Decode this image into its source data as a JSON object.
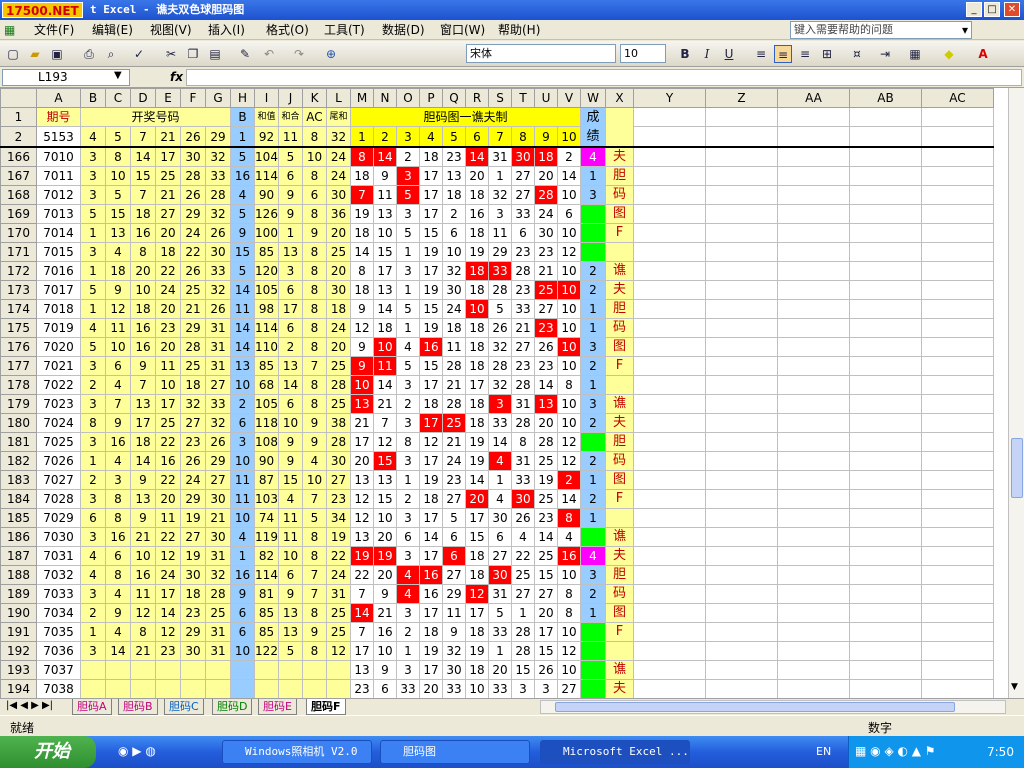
{
  "window": {
    "logo": "17500.NET",
    "title": "t Excel - 谯夫双色球胆码图",
    "buttons": [
      "_",
      "□",
      "✕"
    ]
  },
  "menu": [
    "文件(F)",
    "编辑(E)",
    "视图(V)",
    "插入(I)",
    "格式(O)",
    "工具(T)",
    "数据(D)",
    "窗口(W)",
    "帮助(H)"
  ],
  "help_placeholder": "键入需要帮助的问题",
  "toolbar": {
    "font": "宋体",
    "size": "10",
    "bold": "B",
    "italic": "I",
    "underline": "U"
  },
  "formula": {
    "namebox": "L193",
    "fx": "fx",
    "value": ""
  },
  "columns": [
    "A",
    "B",
    "C",
    "D",
    "E",
    "F",
    "G",
    "H",
    "I",
    "J",
    "K",
    "L",
    "M",
    "N",
    "O",
    "P",
    "Q",
    "R",
    "S",
    "T",
    "U",
    "V",
    "W",
    "X",
    "Y",
    "Z",
    "AA",
    "AB",
    "AC"
  ],
  "header_row1": {
    "row": "1",
    "period": "期号",
    "kjhm": "开奖号码",
    "blue": "B",
    "hezhi": "和值",
    "hehe": "和合",
    "ac": "AC",
    "weihe": "尾和",
    "danma": "胆码图一谯夫制",
    "chengji": "成绩"
  },
  "header_row2": {
    "row": "2",
    "period": "5153",
    "nums": [
      "4",
      "5",
      "7",
      "21",
      "26",
      "29"
    ],
    "blue": "1",
    "hezhi": "92",
    "hehe": "11",
    "ac": "8",
    "weihe": "32",
    "danma": [
      "1",
      "2",
      "3",
      "4",
      "5",
      "6",
      "7",
      "8",
      "9",
      "10"
    ],
    "chengji": ""
  },
  "rows": [
    {
      "r": "166",
      "p": "7010",
      "n": [
        "3",
        "8",
        "14",
        "17",
        "30",
        "32"
      ],
      "b": "5",
      "h": "104",
      "hh": "5",
      "ac": "10",
      "w": "24",
      "m": [
        "8",
        "14",
        "2",
        "18",
        "23",
        "14",
        "31",
        "30",
        "18",
        "2"
      ],
      "red": [
        0,
        1,
        5,
        7,
        8
      ],
      "s": "4",
      "sc": "m",
      "x": "夫"
    },
    {
      "r": "167",
      "p": "7011",
      "n": [
        "3",
        "10",
        "15",
        "25",
        "28",
        "33"
      ],
      "b": "16",
      "h": "114",
      "hh": "6",
      "ac": "8",
      "w": "24",
      "m": [
        "18",
        "9",
        "3",
        "17",
        "13",
        "20",
        "1",
        "27",
        "20",
        "14"
      ],
      "red": [
        2
      ],
      "s": "1",
      "sc": "b",
      "x": "胆"
    },
    {
      "r": "168",
      "p": "7012",
      "n": [
        "3",
        "5",
        "7",
        "21",
        "26",
        "28"
      ],
      "b": "4",
      "h": "90",
      "hh": "9",
      "ac": "6",
      "w": "30",
      "m": [
        "7",
        "11",
        "5",
        "17",
        "18",
        "18",
        "32",
        "27",
        "28",
        "10"
      ],
      "red": [
        0,
        2,
        8
      ],
      "s": "3",
      "sc": "b",
      "x": "码"
    },
    {
      "r": "169",
      "p": "7013",
      "n": [
        "5",
        "15",
        "18",
        "27",
        "29",
        "32"
      ],
      "b": "5",
      "h": "126",
      "hh": "9",
      "ac": "8",
      "w": "36",
      "m": [
        "19",
        "13",
        "3",
        "17",
        "2",
        "16",
        "3",
        "33",
        "24",
        "6"
      ],
      "red": [],
      "s": "",
      "sc": "g",
      "x": "图"
    },
    {
      "r": "170",
      "p": "7014",
      "n": [
        "1",
        "13",
        "16",
        "20",
        "24",
        "26"
      ],
      "b": "9",
      "h": "100",
      "hh": "1",
      "ac": "9",
      "w": "20",
      "m": [
        "18",
        "10",
        "5",
        "15",
        "6",
        "18",
        "11",
        "6",
        "30",
        "10"
      ],
      "red": [],
      "s": "",
      "sc": "g",
      "x": "F"
    },
    {
      "r": "171",
      "p": "7015",
      "n": [
        "3",
        "4",
        "8",
        "18",
        "22",
        "30"
      ],
      "b": "15",
      "h": "85",
      "hh": "13",
      "ac": "8",
      "w": "25",
      "m": [
        "14",
        "15",
        "1",
        "19",
        "10",
        "19",
        "29",
        "23",
        "23",
        "12"
      ],
      "red": [],
      "s": "",
      "sc": "g",
      "x": ""
    },
    {
      "r": "172",
      "p": "7016",
      "n": [
        "1",
        "18",
        "20",
        "22",
        "26",
        "33"
      ],
      "b": "5",
      "h": "120",
      "hh": "3",
      "ac": "8",
      "w": "20",
      "m": [
        "8",
        "17",
        "3",
        "17",
        "32",
        "18",
        "33",
        "28",
        "21",
        "10"
      ],
      "red": [
        5,
        6
      ],
      "s": "2",
      "sc": "b",
      "x": "谯"
    },
    {
      "r": "173",
      "p": "7017",
      "n": [
        "5",
        "9",
        "10",
        "24",
        "25",
        "32"
      ],
      "b": "14",
      "h": "105",
      "hh": "6",
      "ac": "8",
      "w": "30",
      "m": [
        "18",
        "13",
        "1",
        "19",
        "30",
        "18",
        "28",
        "23",
        "25",
        "10"
      ],
      "red": [
        8,
        9
      ],
      "s": "2",
      "sc": "b",
      "x": "夫"
    },
    {
      "r": "174",
      "p": "7018",
      "n": [
        "1",
        "12",
        "18",
        "20",
        "21",
        "26"
      ],
      "b": "11",
      "h": "98",
      "hh": "17",
      "ac": "8",
      "w": "18",
      "m": [
        "9",
        "14",
        "5",
        "15",
        "24",
        "10",
        "5",
        "33",
        "27",
        "10"
      ],
      "red": [
        5
      ],
      "s": "1",
      "sc": "b",
      "x": "胆"
    },
    {
      "r": "175",
      "p": "7019",
      "n": [
        "4",
        "11",
        "16",
        "23",
        "29",
        "31"
      ],
      "b": "14",
      "h": "114",
      "hh": "6",
      "ac": "8",
      "w": "24",
      "m": [
        "12",
        "18",
        "1",
        "19",
        "18",
        "18",
        "26",
        "21",
        "23",
        "10"
      ],
      "red": [
        8
      ],
      "s": "1",
      "sc": "b",
      "x": "码"
    },
    {
      "r": "176",
      "p": "7020",
      "n": [
        "5",
        "10",
        "16",
        "20",
        "28",
        "31"
      ],
      "b": "14",
      "h": "110",
      "hh": "2",
      "ac": "8",
      "w": "20",
      "m": [
        "9",
        "10",
        "4",
        "16",
        "11",
        "18",
        "32",
        "27",
        "26",
        "10"
      ],
      "red": [
        1,
        3,
        9
      ],
      "s": "3",
      "sc": "b",
      "x": "图"
    },
    {
      "r": "177",
      "p": "7021",
      "n": [
        "3",
        "6",
        "9",
        "11",
        "25",
        "31"
      ],
      "b": "13",
      "h": "85",
      "hh": "13",
      "ac": "7",
      "w": "25",
      "m": [
        "9",
        "11",
        "5",
        "15",
        "28",
        "18",
        "28",
        "23",
        "23",
        "10"
      ],
      "red": [
        0,
        1
      ],
      "s": "2",
      "sc": "b",
      "x": "F"
    },
    {
      "r": "178",
      "p": "7022",
      "n": [
        "2",
        "4",
        "7",
        "10",
        "18",
        "27"
      ],
      "b": "10",
      "h": "68",
      "hh": "14",
      "ac": "8",
      "w": "28",
      "m": [
        "10",
        "14",
        "3",
        "17",
        "21",
        "17",
        "32",
        "28",
        "14",
        "8"
      ],
      "red": [
        0
      ],
      "s": "1",
      "sc": "b",
      "x": ""
    },
    {
      "r": "179",
      "p": "7023",
      "n": [
        "3",
        "7",
        "13",
        "17",
        "32",
        "33"
      ],
      "b": "2",
      "h": "105",
      "hh": "6",
      "ac": "8",
      "w": "25",
      "m": [
        "13",
        "21",
        "2",
        "18",
        "28",
        "18",
        "3",
        "31",
        "13",
        "10"
      ],
      "red": [
        0,
        6,
        8
      ],
      "s": "3",
      "sc": "b",
      "x": "谯"
    },
    {
      "r": "180",
      "p": "7024",
      "n": [
        "8",
        "9",
        "17",
        "25",
        "27",
        "32"
      ],
      "b": "6",
      "h": "118",
      "hh": "10",
      "ac": "9",
      "w": "38",
      "m": [
        "21",
        "7",
        "3",
        "17",
        "25",
        "18",
        "33",
        "28",
        "20",
        "10"
      ],
      "red": [
        3,
        4
      ],
      "s": "2",
      "sc": "b",
      "x": "夫"
    },
    {
      "r": "181",
      "p": "7025",
      "n": [
        "3",
        "16",
        "18",
        "22",
        "23",
        "26"
      ],
      "b": "3",
      "h": "108",
      "hh": "9",
      "ac": "9",
      "w": "28",
      "m": [
        "17",
        "12",
        "8",
        "12",
        "21",
        "19",
        "14",
        "8",
        "28",
        "12"
      ],
      "red": [],
      "s": "",
      "sc": "g",
      "x": "胆"
    },
    {
      "r": "182",
      "p": "7026",
      "n": [
        "1",
        "4",
        "14",
        "16",
        "26",
        "29"
      ],
      "b": "10",
      "h": "90",
      "hh": "9",
      "ac": "4",
      "w": "30",
      "m": [
        "20",
        "15",
        "3",
        "17",
        "24",
        "19",
        "4",
        "31",
        "25",
        "12"
      ],
      "red": [
        1,
        6
      ],
      "s": "2",
      "sc": "b",
      "x": "码"
    },
    {
      "r": "183",
      "p": "7027",
      "n": [
        "2",
        "3",
        "9",
        "22",
        "24",
        "27"
      ],
      "b": "11",
      "h": "87",
      "hh": "15",
      "ac": "10",
      "w": "27",
      "m": [
        "13",
        "13",
        "1",
        "19",
        "23",
        "14",
        "1",
        "33",
        "19",
        "2"
      ],
      "red": [
        9
      ],
      "s": "1",
      "sc": "b",
      "x": "图"
    },
    {
      "r": "184",
      "p": "7028",
      "n": [
        "3",
        "8",
        "13",
        "20",
        "29",
        "30"
      ],
      "b": "11",
      "h": "103",
      "hh": "4",
      "ac": "7",
      "w": "23",
      "m": [
        "12",
        "15",
        "2",
        "18",
        "27",
        "20",
        "4",
        "30",
        "25",
        "14"
      ],
      "red": [
        5,
        7
      ],
      "s": "2",
      "sc": "b",
      "x": "F"
    },
    {
      "r": "185",
      "p": "7029",
      "n": [
        "6",
        "8",
        "9",
        "11",
        "19",
        "21"
      ],
      "b": "10",
      "h": "74",
      "hh": "11",
      "ac": "5",
      "w": "34",
      "m": [
        "12",
        "10",
        "3",
        "17",
        "5",
        "17",
        "30",
        "26",
        "23",
        "8"
      ],
      "red": [
        9
      ],
      "s": "1",
      "sc": "b",
      "x": ""
    },
    {
      "r": "186",
      "p": "7030",
      "n": [
        "3",
        "16",
        "21",
        "22",
        "27",
        "30"
      ],
      "b": "4",
      "h": "119",
      "hh": "11",
      "ac": "8",
      "w": "19",
      "m": [
        "13",
        "20",
        "6",
        "14",
        "6",
        "15",
        "6",
        "4",
        "14",
        "4"
      ],
      "red": [],
      "s": "",
      "sc": "g",
      "x": "谯"
    },
    {
      "r": "187",
      "p": "7031",
      "n": [
        "4",
        "6",
        "10",
        "12",
        "19",
        "31"
      ],
      "b": "1",
      "h": "82",
      "hh": "10",
      "ac": "8",
      "w": "22",
      "m": [
        "19",
        "19",
        "3",
        "17",
        "6",
        "18",
        "27",
        "22",
        "25",
        "16"
      ],
      "red": [
        0,
        1,
        4,
        9
      ],
      "s": "4",
      "sc": "m",
      "x": "夫"
    },
    {
      "r": "188",
      "p": "7032",
      "n": [
        "4",
        "8",
        "16",
        "24",
        "30",
        "32"
      ],
      "b": "16",
      "h": "114",
      "hh": "6",
      "ac": "7",
      "w": "24",
      "m": [
        "22",
        "20",
        "4",
        "16",
        "27",
        "18",
        "30",
        "25",
        "15",
        "10"
      ],
      "red": [
        2,
        3,
        6
      ],
      "s": "3",
      "sc": "b",
      "x": "胆"
    },
    {
      "r": "189",
      "p": "7033",
      "n": [
        "3",
        "4",
        "11",
        "17",
        "18",
        "28"
      ],
      "b": "9",
      "h": "81",
      "hh": "9",
      "ac": "7",
      "w": "31",
      "m": [
        "7",
        "9",
        "4",
        "16",
        "29",
        "12",
        "31",
        "27",
        "27",
        "8"
      ],
      "red": [
        2,
        5
      ],
      "s": "2",
      "sc": "b",
      "x": "码"
    },
    {
      "r": "190",
      "p": "7034",
      "n": [
        "2",
        "9",
        "12",
        "14",
        "23",
        "25"
      ],
      "b": "6",
      "h": "85",
      "hh": "13",
      "ac": "8",
      "w": "25",
      "m": [
        "14",
        "21",
        "3",
        "17",
        "11",
        "17",
        "5",
        "1",
        "20",
        "8"
      ],
      "red": [
        0
      ],
      "s": "1",
      "sc": "b",
      "x": "图"
    },
    {
      "r": "191",
      "p": "7035",
      "n": [
        "1",
        "4",
        "8",
        "12",
        "29",
        "31"
      ],
      "b": "6",
      "h": "85",
      "hh": "13",
      "ac": "9",
      "w": "25",
      "m": [
        "7",
        "16",
        "2",
        "18",
        "9",
        "18",
        "33",
        "28",
        "17",
        "10"
      ],
      "red": [],
      "s": "",
      "sc": "g",
      "x": "F"
    },
    {
      "r": "192",
      "p": "7036",
      "n": [
        "3",
        "14",
        "21",
        "23",
        "30",
        "31"
      ],
      "b": "10",
      "h": "122",
      "hh": "5",
      "ac": "8",
      "w": "12",
      "m": [
        "17",
        "10",
        "1",
        "19",
        "32",
        "19",
        "1",
        "28",
        "15",
        "12"
      ],
      "red": [],
      "s": "",
      "sc": "g",
      "x": ""
    },
    {
      "r": "193",
      "p": "7037",
      "n": [
        "",
        "",
        "",
        "",
        "",
        ""
      ],
      "b": "",
      "h": "",
      "hh": "",
      "ac": "",
      "w": "",
      "m": [
        "13",
        "9",
        "3",
        "17",
        "30",
        "18",
        "20",
        "15",
        "26",
        "10"
      ],
      "red": [],
      "s": "",
      "sc": "g",
      "x": "谯"
    },
    {
      "r": "194",
      "p": "7038",
      "n": [
        "",
        "",
        "",
        "",
        "",
        ""
      ],
      "b": "",
      "h": "",
      "hh": "",
      "ac": "",
      "w": "",
      "m": [
        "23",
        "6",
        "33",
        "20",
        "33",
        "10",
        "33",
        "3",
        "3",
        "27"
      ],
      "red": [],
      "s": "",
      "sc": "g",
      "x": "夫"
    }
  ],
  "sheets": [
    "胆码A",
    "胆码B",
    "胆码C",
    "胆码D",
    "胆码E",
    "胆码F"
  ],
  "status": {
    "left": "就绪",
    "right": "数字"
  },
  "taskbar": {
    "start": "开始",
    "tasks": [
      "Windows照相机 V2.0",
      "胆码图",
      "Microsoft Excel ..."
    ],
    "lang": "EN",
    "clock": "7:50"
  },
  "colors": {
    "yellow": "#ffff99",
    "blue": "#99ccff",
    "red": "#ff0000",
    "green": "#00ff00",
    "magenta": "#ff00ff"
  }
}
